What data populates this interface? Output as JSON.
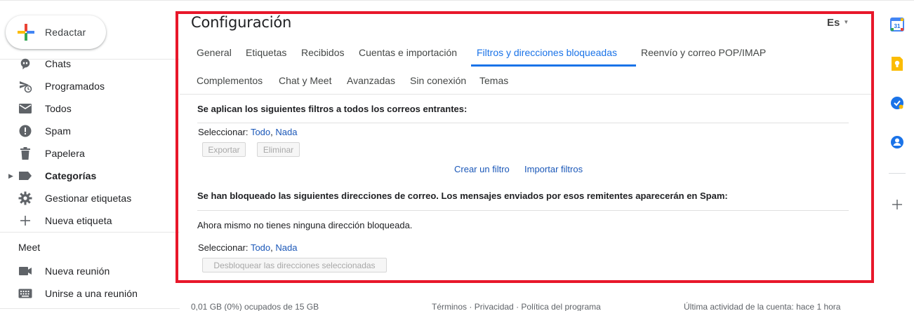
{
  "sidebar": {
    "compose_label": "Redactar",
    "items": [
      {
        "label": "Chats",
        "icon": "chat-bubble-icon"
      },
      {
        "label": "Programados",
        "icon": "scheduled-send-icon"
      },
      {
        "label": "Todos",
        "icon": "all-mail-icon"
      },
      {
        "label": "Spam",
        "icon": "spam-icon"
      },
      {
        "label": "Papelera",
        "icon": "trash-icon"
      },
      {
        "label": "Categorías",
        "icon": "label-icon"
      },
      {
        "label": "Gestionar etiquetas",
        "icon": "gear-icon"
      },
      {
        "label": "Nueva etiqueta",
        "icon": "plus-icon"
      }
    ],
    "meet": {
      "header": "Meet",
      "items": [
        {
          "label": "Nueva reunión",
          "icon": "video-camera-icon"
        },
        {
          "label": "Unirse a una reunión",
          "icon": "keyboard-icon"
        }
      ]
    }
  },
  "settings": {
    "title": "Configuración",
    "language": "Es",
    "tabs_row1": [
      "General",
      "Etiquetas",
      "Recibidos",
      "Cuentas e importación",
      "Filtros y direcciones bloqueadas",
      "Reenvío y correo POP/IMAP"
    ],
    "tabs_row2": [
      "Complementos",
      "Chat y Meet",
      "Avanzadas",
      "Sin conexión",
      "Temas"
    ],
    "active_tab": "Filtros y direcciones bloqueadas",
    "filters": {
      "heading": "Se aplican los siguientes filtros a todos los correos entrantes:",
      "select_label": "Seleccionar:",
      "select_all": "Todo",
      "select_none": "Nada",
      "export_button": "Exportar",
      "delete_button": "Eliminar",
      "create_filter": "Crear un filtro",
      "import_filters": "Importar filtros"
    },
    "blocked": {
      "heading": "Se han bloqueado las siguientes direcciones de correo. Los mensajes enviados por esos remitentes aparecerán en Spam:",
      "empty_message": "Ahora mismo no tienes ninguna dirección bloqueada.",
      "select_label": "Seleccionar:",
      "select_all": "Todo",
      "select_none": "Nada",
      "unblock_button": "Desbloquear las direcciones seleccionadas"
    }
  },
  "footer": {
    "storage": "0,01 GB (0%) ocupados de 15 GB",
    "terms": "Términos",
    "privacy": "Privacidad",
    "program_policy": "Política del programa",
    "separator": "·",
    "last_activity": "Última actividad de la cuenta: hace 1 hora"
  },
  "side_panel": {
    "calendar_day": "31",
    "icons": [
      "calendar-icon",
      "keep-icon",
      "tasks-icon",
      "contacts-icon",
      "add-icon"
    ]
  },
  "colors": {
    "accent": "#1a73e8",
    "highlight_border": "#e8172a"
  }
}
